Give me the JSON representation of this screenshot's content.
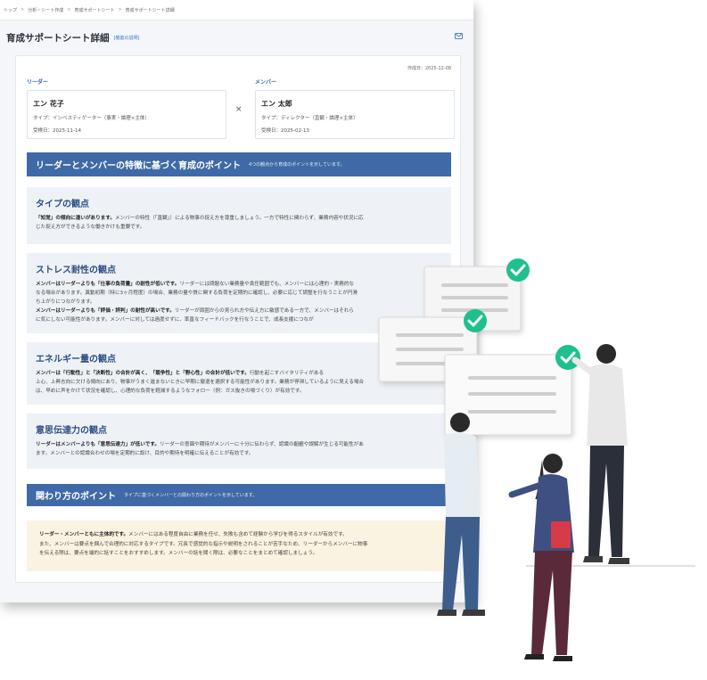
{
  "breadcrumb": [
    "トップ",
    "分析・シート作成",
    "育成サポートシート",
    "育成サポートシート詳細"
  ],
  "page": {
    "title": "育成サポートシート詳細",
    "help_link": "[機能の説明]"
  },
  "created": "作成日：2025-12-08",
  "leader": {
    "role": "リーダー",
    "name": "エン 花子",
    "type": "タイプ：インベスティゲーター（事実・論理×主体）",
    "date": "受検日：2025-11-14"
  },
  "member": {
    "role": "メンバー",
    "name": "エン 太郎",
    "type": "タイプ：ディレクター（直観・論理×主体）",
    "date": "受検日：2025-02-13"
  },
  "times_symbol": "×",
  "points_band": {
    "title": "リーダーとメンバーの特徴に基づく育成のポイント",
    "subtitle": "4つの観点から育成のポイントを示しています。"
  },
  "sections": [
    {
      "title": "タイプの観点",
      "lines": [
        {
          "bold": "「知覚」の傾向に違いがあります。",
          "text": "メンバーの特性（「直観」）による物事の捉え方を尊重しましょう。一方で特性に関わらず、業務内容や状況に応"
        },
        {
          "bold": "",
          "text": "じた捉え方ができるような働きかけも重要です。"
        }
      ]
    },
    {
      "title": "ストレス耐性の観点",
      "lines": [
        {
          "bold": "メンバーはリーダーよりも「仕事の負荷量」の耐性が低いです。",
          "text": "リーダーには問題ない業務量や責任範囲でも、メンバーには心理的・実務的な"
        },
        {
          "bold": "",
          "text": "なる場合があります。異動初期（特に3ヶ月程度）の場合、業務の量や質に関する負荷を定期的に確認し、必要に応じて調整を行なうことが円滑"
        },
        {
          "bold": "",
          "text": "ち上がりにつながります。"
        },
        {
          "bold": "メンバーはリーダーよりも「評価・評判」の耐性が高いです。",
          "text": "リーダーが周囲からの見られ方や伝え方に敏感である一方で、メンバーはそれら"
        },
        {
          "bold": "",
          "text": "に気にしない可能性があります。メンバーに対しては過度せずに、率直なフィードバックを行なうことで、成長支援につなが"
        }
      ]
    },
    {
      "title": "エネルギー量の観点",
      "lines": [
        {
          "bold": "メンバーは「行動性」と「決断性」の合計が高く、「競争性」と「野心性」の合計が低いです。",
          "text": "行動を起こすバイタリティがある"
        },
        {
          "bold": "",
          "text": "上心、上昇志向に欠ける傾向にあり、物事がうまく進まないときに早期に撤退を選択する可能性があります。業務が停滞しているように見える場合"
        },
        {
          "bold": "",
          "text": "は、早めに声をかけて状況を確認し、心理的な負荷を軽減するようなフォロー（例：ガス抜きの場づくり）が有効です。"
        }
      ]
    },
    {
      "title": "意思伝達力の観点",
      "lines": [
        {
          "bold": "リーダーはメンバーよりも「意思伝達力」が低いです。",
          "text": "リーダーの意図や期待がメンバーに十分に伝わらず、認識の齟齬や誤解が生じる可能性があ"
        },
        {
          "bold": "",
          "text": "ます。メンバーとの認識合わせの場を定期的に設け、目的や期待を明確に伝えることが有効です。"
        }
      ]
    }
  ],
  "relation_band": {
    "title": "関わり方のポイント",
    "subtitle": "タイプに基づくメンバーとの関わり方のポイントを示しています。"
  },
  "relation_note": {
    "lines": [
      {
        "bold": "リーダー・メンバーともに主体的です。",
        "text": "メンバーにはある程度自由に業務を任せ、失敗も含めて経験から学びを得るスタイルが有効です。"
      },
      {
        "bold": "",
        "text": "また、メンバーは要点を掴んで合理的に対応するタイプです。冗長で感覚的な指示や説明をされることが苦手なため、リーダーからメンバーに物事"
      },
      {
        "bold": "",
        "text": "を伝える際は、要点を端的に話すことをおすすめします。メンバーの話を聞く際は、必要なことをまとめて確認しましょう。"
      }
    ]
  },
  "colors": {
    "band": "#3f6aa7",
    "section_bg": "#eef2f7",
    "note_bg": "#fbf3e2",
    "check": "#1fbf8f"
  },
  "icons": [
    "mail-icon",
    "check-icon"
  ]
}
